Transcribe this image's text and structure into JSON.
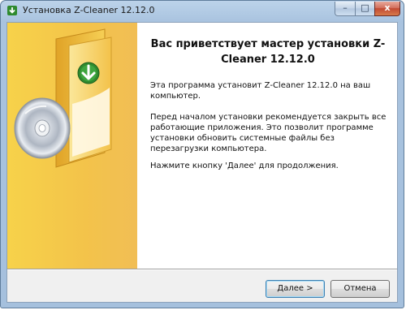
{
  "window": {
    "title": "Установка Z-Cleaner 12.12.0",
    "controls": {
      "minimize": "–",
      "maximize": "□",
      "close": "x"
    }
  },
  "welcome": {
    "heading": "Вас приветствует мастер установки Z-Cleaner 12.12.0",
    "paragraph1": "Эта программа установит Z-Cleaner 12.12.0 на ваш компьютер.",
    "paragraph2": "Перед началом установки рекомендуется закрыть все работающие приложения. Это позволит программе установки обновить системные файлы без перезагрузки компьютера.",
    "paragraph3": "Нажмите кнопку 'Далее' для продолжения."
  },
  "buttons": {
    "next": "Далее >",
    "cancel": "Отмена"
  },
  "icons": {
    "app": "installer-icon",
    "box": "software-box-icon",
    "cd": "cd-disc-icon",
    "download": "download-arrow-icon"
  },
  "colors": {
    "side_panel": "#f3c34a",
    "download_badge": "#2f8a2f",
    "title_bar": "#bcd3ea"
  }
}
